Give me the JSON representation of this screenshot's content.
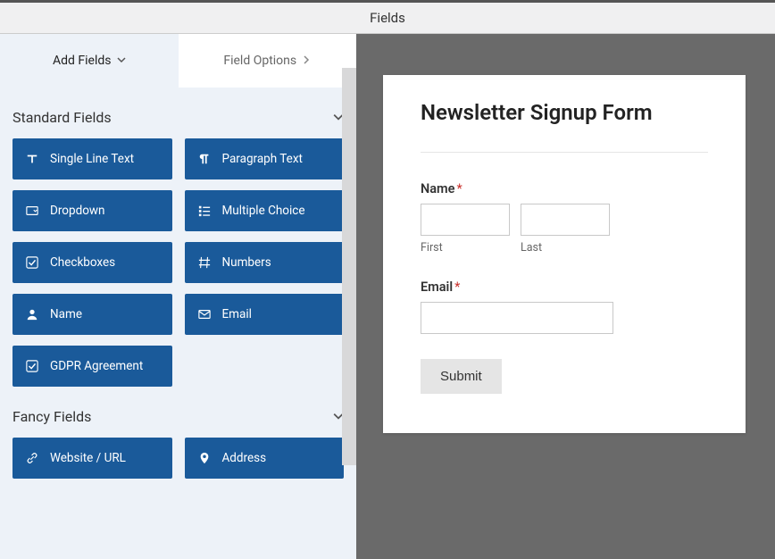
{
  "header": {
    "title": "Fields"
  },
  "tabs": {
    "add_fields": "Add Fields",
    "field_options": "Field Options"
  },
  "sections": {
    "standard": {
      "title": "Standard Fields",
      "fields": [
        {
          "icon": "text-icon",
          "label": "Single Line Text"
        },
        {
          "icon": "paragraph-icon",
          "label": "Paragraph Text"
        },
        {
          "icon": "dropdown-icon",
          "label": "Dropdown"
        },
        {
          "icon": "list-icon",
          "label": "Multiple Choice"
        },
        {
          "icon": "check-icon",
          "label": "Checkboxes"
        },
        {
          "icon": "hash-icon",
          "label": "Numbers"
        },
        {
          "icon": "user-icon",
          "label": "Name"
        },
        {
          "icon": "envelope-icon",
          "label": "Email"
        },
        {
          "icon": "check-icon",
          "label": "GDPR Agreement"
        }
      ]
    },
    "fancy": {
      "title": "Fancy Fields",
      "fields": [
        {
          "icon": "link-icon",
          "label": "Website / URL"
        },
        {
          "icon": "pin-icon",
          "label": "Address"
        }
      ]
    }
  },
  "preview": {
    "form_title": "Newsletter Signup Form",
    "name_label": "Name",
    "first_label": "First",
    "last_label": "Last",
    "email_label": "Email",
    "submit_label": "Submit",
    "required_mark": "*"
  }
}
